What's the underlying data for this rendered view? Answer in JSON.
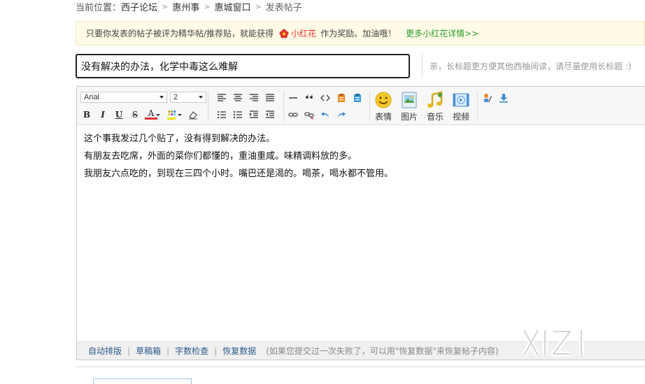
{
  "breadcrumb": {
    "prefix": "当前位置：",
    "items": [
      "西子论坛",
      "惠州事",
      "惠城窗口"
    ],
    "current": "发表帖子",
    "separator": ">"
  },
  "notice": {
    "text_before": "只要你发表的帖子被评为精华帖/推荐贴，就能获得",
    "flower_label": "小红花",
    "text_after": "作为奖励。加油哦！",
    "more_link": "更多小红花详情>>",
    "flower_icon": "red-flower-icon"
  },
  "title_field": {
    "value": "没有解决的办法，化学中毒这么难解",
    "hint": "亲，长标题更方便其他西柚阅读，请尽量使用长标题 :)"
  },
  "toolbar": {
    "font_family": "Arial",
    "font_size": "2",
    "buttons_row1": [
      "align-left-icon",
      "align-center-icon",
      "align-right-icon",
      "align-justify-icon",
      "horizontal-rule-icon",
      "quote-icon",
      "code-icon",
      "paste-word-icon",
      "paste-text-icon"
    ],
    "buttons_row2": [
      "ordered-list-icon",
      "unordered-list-icon",
      "indent-icon",
      "outdent-icon",
      "link-icon",
      "unlink-icon",
      "undo-icon",
      "redo-icon"
    ],
    "bold": "B",
    "italic": "I",
    "underline": "U",
    "strike": "S",
    "font_color": "A",
    "media": [
      {
        "label": "表情",
        "icon": "smiley-icon"
      },
      {
        "label": "图片",
        "icon": "image-icon"
      },
      {
        "label": "音乐",
        "icon": "music-icon"
      },
      {
        "label": "视频",
        "icon": "video-icon"
      }
    ],
    "extra": [
      "edit-icon",
      "download-icon"
    ]
  },
  "content": {
    "lines": [
      "这个事我发过几个贴了，没有得到解决的办法。",
      "有朋友去吃席，外面的菜你们都懂的，重油重咸。味精调料放的多。",
      "我朋友六点吃的，到现在三四个小时。嘴巴还是渴的。喝茶，喝水都不管用。"
    ]
  },
  "status_bar": {
    "links": [
      "自动排版",
      "草稿箱",
      "字数检查",
      "恢复数据"
    ],
    "note": "(如果您提交过一次失败了，可以用\"恢复数据\"来恢复帖子内容)"
  },
  "watermark": {
    "text": "XIZI"
  },
  "colors": {
    "notice_bg": "#fffbe6",
    "flower_red": "#e53030",
    "link_green": "#2c9a2c",
    "link_blue": "#2b5a8a"
  }
}
